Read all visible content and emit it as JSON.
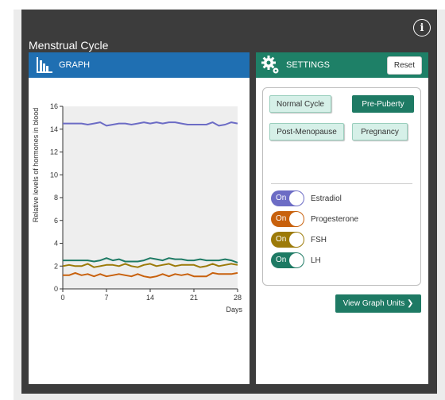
{
  "app": {
    "title": "Menstrual Cycle",
    "info_icon": "i"
  },
  "graph_panel": {
    "header": "GRAPH",
    "icon": "bar-chart-icon"
  },
  "settings_panel": {
    "header": "SETTINGS",
    "icon": "gears-icon",
    "reset_label": "Reset",
    "cycle_buttons": [
      {
        "label": "Normal Cycle",
        "selected": false
      },
      {
        "label": "Pre-Puberty",
        "selected": true
      },
      {
        "label": "Post-Menopause",
        "selected": false
      },
      {
        "label": "Pregnancy",
        "selected": false
      }
    ],
    "toggles": [
      {
        "state": "On",
        "label": "Estradiol",
        "color": "#6c6cc5"
      },
      {
        "state": "On",
        "label": "Progesterone",
        "color": "#c8610d"
      },
      {
        "state": "On",
        "label": "FSH",
        "color": "#9c7a08"
      },
      {
        "state": "On",
        "label": "LH",
        "color": "#1e7a64"
      }
    ],
    "view_units_label": "View Graph Units ❯"
  },
  "chart_data": {
    "type": "line",
    "xlabel": "Days",
    "ylabel": "Relative levels of hormones in blood",
    "xlim": [
      0,
      28
    ],
    "ylim": [
      0,
      16
    ],
    "xticks": [
      "0",
      "7",
      "14",
      "21",
      "28"
    ],
    "yticks": [
      "0",
      "2",
      "4",
      "6",
      "8",
      "10",
      "12",
      "14",
      "16"
    ],
    "grid": false,
    "series": [
      {
        "color": "#6c6cc5",
        "x": [
          0,
          1,
          2,
          3,
          4,
          5,
          6,
          7,
          8,
          9,
          10,
          11,
          12,
          13,
          14,
          15,
          16,
          17,
          18,
          19,
          20,
          21,
          22,
          23,
          24,
          25,
          26,
          27,
          28
        ],
        "y": [
          14.5,
          14.5,
          14.5,
          14.5,
          14.4,
          14.5,
          14.6,
          14.3,
          14.4,
          14.5,
          14.5,
          14.4,
          14.5,
          14.6,
          14.5,
          14.6,
          14.5,
          14.6,
          14.6,
          14.5,
          14.4,
          14.4,
          14.4,
          14.4,
          14.6,
          14.3,
          14.4,
          14.6,
          14.5
        ]
      },
      {
        "color": "#1e7a64",
        "x": [
          0,
          1,
          2,
          3,
          4,
          5,
          6,
          7,
          8,
          9,
          10,
          11,
          12,
          13,
          14,
          15,
          16,
          17,
          18,
          19,
          20,
          21,
          22,
          23,
          24,
          25,
          26,
          27,
          28
        ],
        "y": [
          2.5,
          2.5,
          2.5,
          2.5,
          2.5,
          2.4,
          2.5,
          2.7,
          2.5,
          2.6,
          2.4,
          2.4,
          2.4,
          2.5,
          2.7,
          2.6,
          2.5,
          2.7,
          2.6,
          2.6,
          2.5,
          2.5,
          2.6,
          2.5,
          2.5,
          2.5,
          2.6,
          2.5,
          2.3
        ]
      },
      {
        "color": "#9c7a08",
        "x": [
          0,
          1,
          2,
          3,
          4,
          5,
          6,
          7,
          8,
          9,
          10,
          11,
          12,
          13,
          14,
          15,
          16,
          17,
          18,
          19,
          20,
          21,
          22,
          23,
          24,
          25,
          26,
          27,
          28
        ],
        "y": [
          2.0,
          2.1,
          2.0,
          2.0,
          2.2,
          1.9,
          2.0,
          2.1,
          2.1,
          2.0,
          2.2,
          2.0,
          1.9,
          2.1,
          2.2,
          2.0,
          2.1,
          2.2,
          2.0,
          2.1,
          2.1,
          2.1,
          1.9,
          2.0,
          2.2,
          2.0,
          2.1,
          2.2,
          2.1
        ]
      },
      {
        "color": "#c8610d",
        "x": [
          0,
          1,
          2,
          3,
          4,
          5,
          6,
          7,
          8,
          9,
          10,
          11,
          12,
          13,
          14,
          15,
          16,
          17,
          18,
          19,
          20,
          21,
          22,
          23,
          24,
          25,
          26,
          27,
          28
        ],
        "y": [
          1.2,
          1.2,
          1.4,
          1.2,
          1.3,
          1.1,
          1.3,
          1.1,
          1.2,
          1.3,
          1.2,
          1.1,
          1.3,
          1.1,
          1.0,
          1.1,
          1.3,
          1.1,
          1.3,
          1.2,
          1.3,
          1.1,
          1.1,
          1.1,
          1.4,
          1.3,
          1.3,
          1.3,
          1.4
        ]
      }
    ]
  }
}
